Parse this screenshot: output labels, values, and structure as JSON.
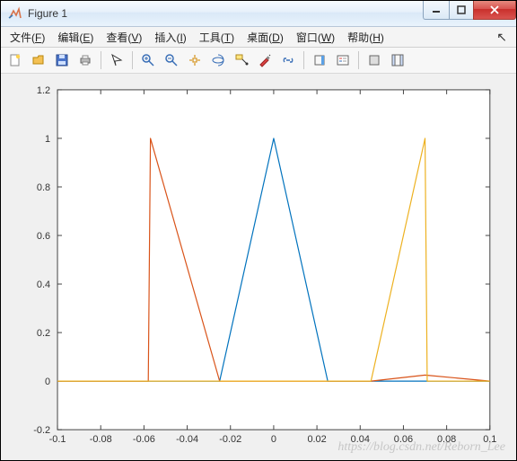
{
  "window": {
    "title": "Figure 1"
  },
  "menu": {
    "items": [
      {
        "label": "文件",
        "key": "F"
      },
      {
        "label": "编辑",
        "key": "E"
      },
      {
        "label": "查看",
        "key": "V"
      },
      {
        "label": "插入",
        "key": "I"
      },
      {
        "label": "工具",
        "key": "T"
      },
      {
        "label": "桌面",
        "key": "D"
      },
      {
        "label": "窗口",
        "key": "W"
      },
      {
        "label": "帮助",
        "key": "H"
      }
    ]
  },
  "watermark": "https://blog.csdn.net/Reborn_Lee",
  "chart_data": {
    "type": "line",
    "xlim": [
      -0.1,
      0.1
    ],
    "ylim": [
      -0.2,
      1.2
    ],
    "xticks": [
      -0.1,
      -0.08,
      -0.06,
      -0.04,
      -0.02,
      0,
      0.02,
      0.04,
      0.06,
      0.08,
      0.1
    ],
    "yticks": [
      -0.2,
      0,
      0.2,
      0.4,
      0.6,
      0.8,
      1,
      1.2
    ],
    "xtick_labels": [
      "-0.1",
      "-0.08",
      "-0.06",
      "-0.04",
      "-0.02",
      "0",
      "0.02",
      "0.04",
      "0.06",
      "0.08",
      "0.1"
    ],
    "ytick_labels": [
      "-0.2",
      "0",
      "0.2",
      "0.4",
      "0.6",
      "0.8",
      "1",
      "1.2"
    ],
    "series": [
      {
        "name": "blue",
        "color": "#0072bd",
        "points": [
          [
            -0.1,
            0
          ],
          [
            -0.025,
            0
          ],
          [
            0,
            1
          ],
          [
            0.025,
            0
          ],
          [
            0.1,
            0
          ]
        ]
      },
      {
        "name": "orange",
        "color": "#d95319",
        "points": [
          [
            -0.1,
            0
          ],
          [
            -0.058,
            0
          ],
          [
            -0.057,
            1
          ],
          [
            -0.025,
            0
          ],
          [
            0.045,
            0
          ],
          [
            0.07,
            0.025
          ],
          [
            0.1,
            0
          ]
        ]
      },
      {
        "name": "yellow",
        "color": "#edb120",
        "points": [
          [
            -0.1,
            0
          ],
          [
            0.045,
            0
          ],
          [
            0.07,
            1
          ],
          [
            0.071,
            0
          ],
          [
            0.1,
            0
          ]
        ]
      }
    ]
  }
}
